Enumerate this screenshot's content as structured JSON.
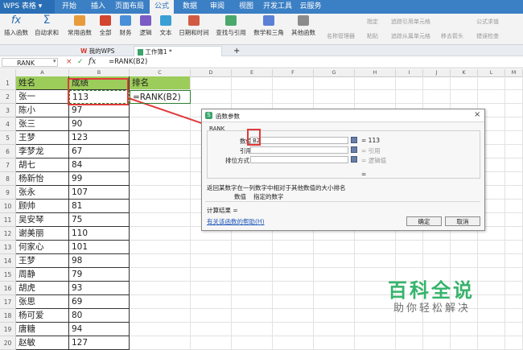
{
  "app": {
    "logo": "WPS 表格"
  },
  "menu_tabs": [
    "开始",
    "插入",
    "页面布局",
    "公式",
    "数据",
    "审阅",
    "视图",
    "开发工具",
    "云服务"
  ],
  "active_tab": "公式",
  "ribbon": {
    "buttons": [
      "插入函数",
      "自动求和",
      "常用函数",
      "全部",
      "财务",
      "逻辑",
      "文本",
      "日期和时间",
      "查找与引用",
      "数学和三角",
      "其他函数"
    ],
    "right_groups": [
      "名称管理器",
      "指定",
      "粘贴",
      "追踪引用单元格",
      "追踪从属单元格",
      "移去箭头",
      "公式求值",
      "错误检查"
    ]
  },
  "doc_tabs": {
    "my_wps": "我的WPS",
    "workbook": "工作簿1 *",
    "plus": "+"
  },
  "formula_bar": {
    "name_box": "RANK",
    "cancel": "×",
    "confirm": "✓",
    "fx": "fx",
    "content": "=RANK(B2)"
  },
  "columns": [
    "A",
    "B",
    "C",
    "D",
    "E",
    "F",
    "G",
    "H",
    "I",
    "J",
    "K",
    "L",
    "M"
  ],
  "rows": [
    [
      "1",
      "姓名",
      "成绩",
      "排名"
    ],
    [
      "2",
      "张一",
      "113",
      "=RANK(B2)"
    ],
    [
      "3",
      "陈小",
      "97",
      ""
    ],
    [
      "4",
      "张三",
      "90",
      ""
    ],
    [
      "5",
      "王梦",
      "123",
      ""
    ],
    [
      "6",
      "李梦龙",
      "67",
      ""
    ],
    [
      "7",
      "胡七",
      "84",
      ""
    ],
    [
      "8",
      "杨新怡",
      "99",
      ""
    ],
    [
      "9",
      "张永",
      "107",
      ""
    ],
    [
      "10",
      "顾帅",
      "81",
      ""
    ],
    [
      "11",
      "吴安琴",
      "75",
      ""
    ],
    [
      "12",
      "谢美丽",
      "110",
      ""
    ],
    [
      "13",
      "何家心",
      "101",
      ""
    ],
    [
      "14",
      "王梦",
      "98",
      ""
    ],
    [
      "15",
      "周静",
      "79",
      ""
    ],
    [
      "16",
      "胡虎",
      "93",
      ""
    ],
    [
      "17",
      "张思",
      "69",
      ""
    ],
    [
      "18",
      "杨可爱",
      "80",
      ""
    ],
    [
      "19",
      "唐糖",
      "94",
      ""
    ],
    [
      "20",
      "赵敏",
      "127",
      ""
    ]
  ],
  "dialog": {
    "title": "函数参数",
    "func_name": "RANK",
    "fields": [
      {
        "label": "数值",
        "value": "B2",
        "result": "= 113"
      },
      {
        "label": "引用",
        "value": "",
        "result": "= 引用"
      },
      {
        "label": "排位方式",
        "value": "",
        "result": "= 逻辑值"
      }
    ],
    "eq": "=",
    "description": "返回某数字在一列数字中相对于其他数值的大小排名",
    "param_name": "数值",
    "param_desc": "指定的数字",
    "result_label": "计算结果 =",
    "help_link": "有关该函数的帮助(H)",
    "ok": "确定",
    "cancel": "取消"
  },
  "watermark": {
    "title": "百科全说",
    "subtitle": "助你轻松解决"
  },
  "colors": {
    "accent": "#3b7fc4",
    "header_fill": "#9ccc5a",
    "highlight": "#e03a3a",
    "watermark": "#35b46b"
  }
}
